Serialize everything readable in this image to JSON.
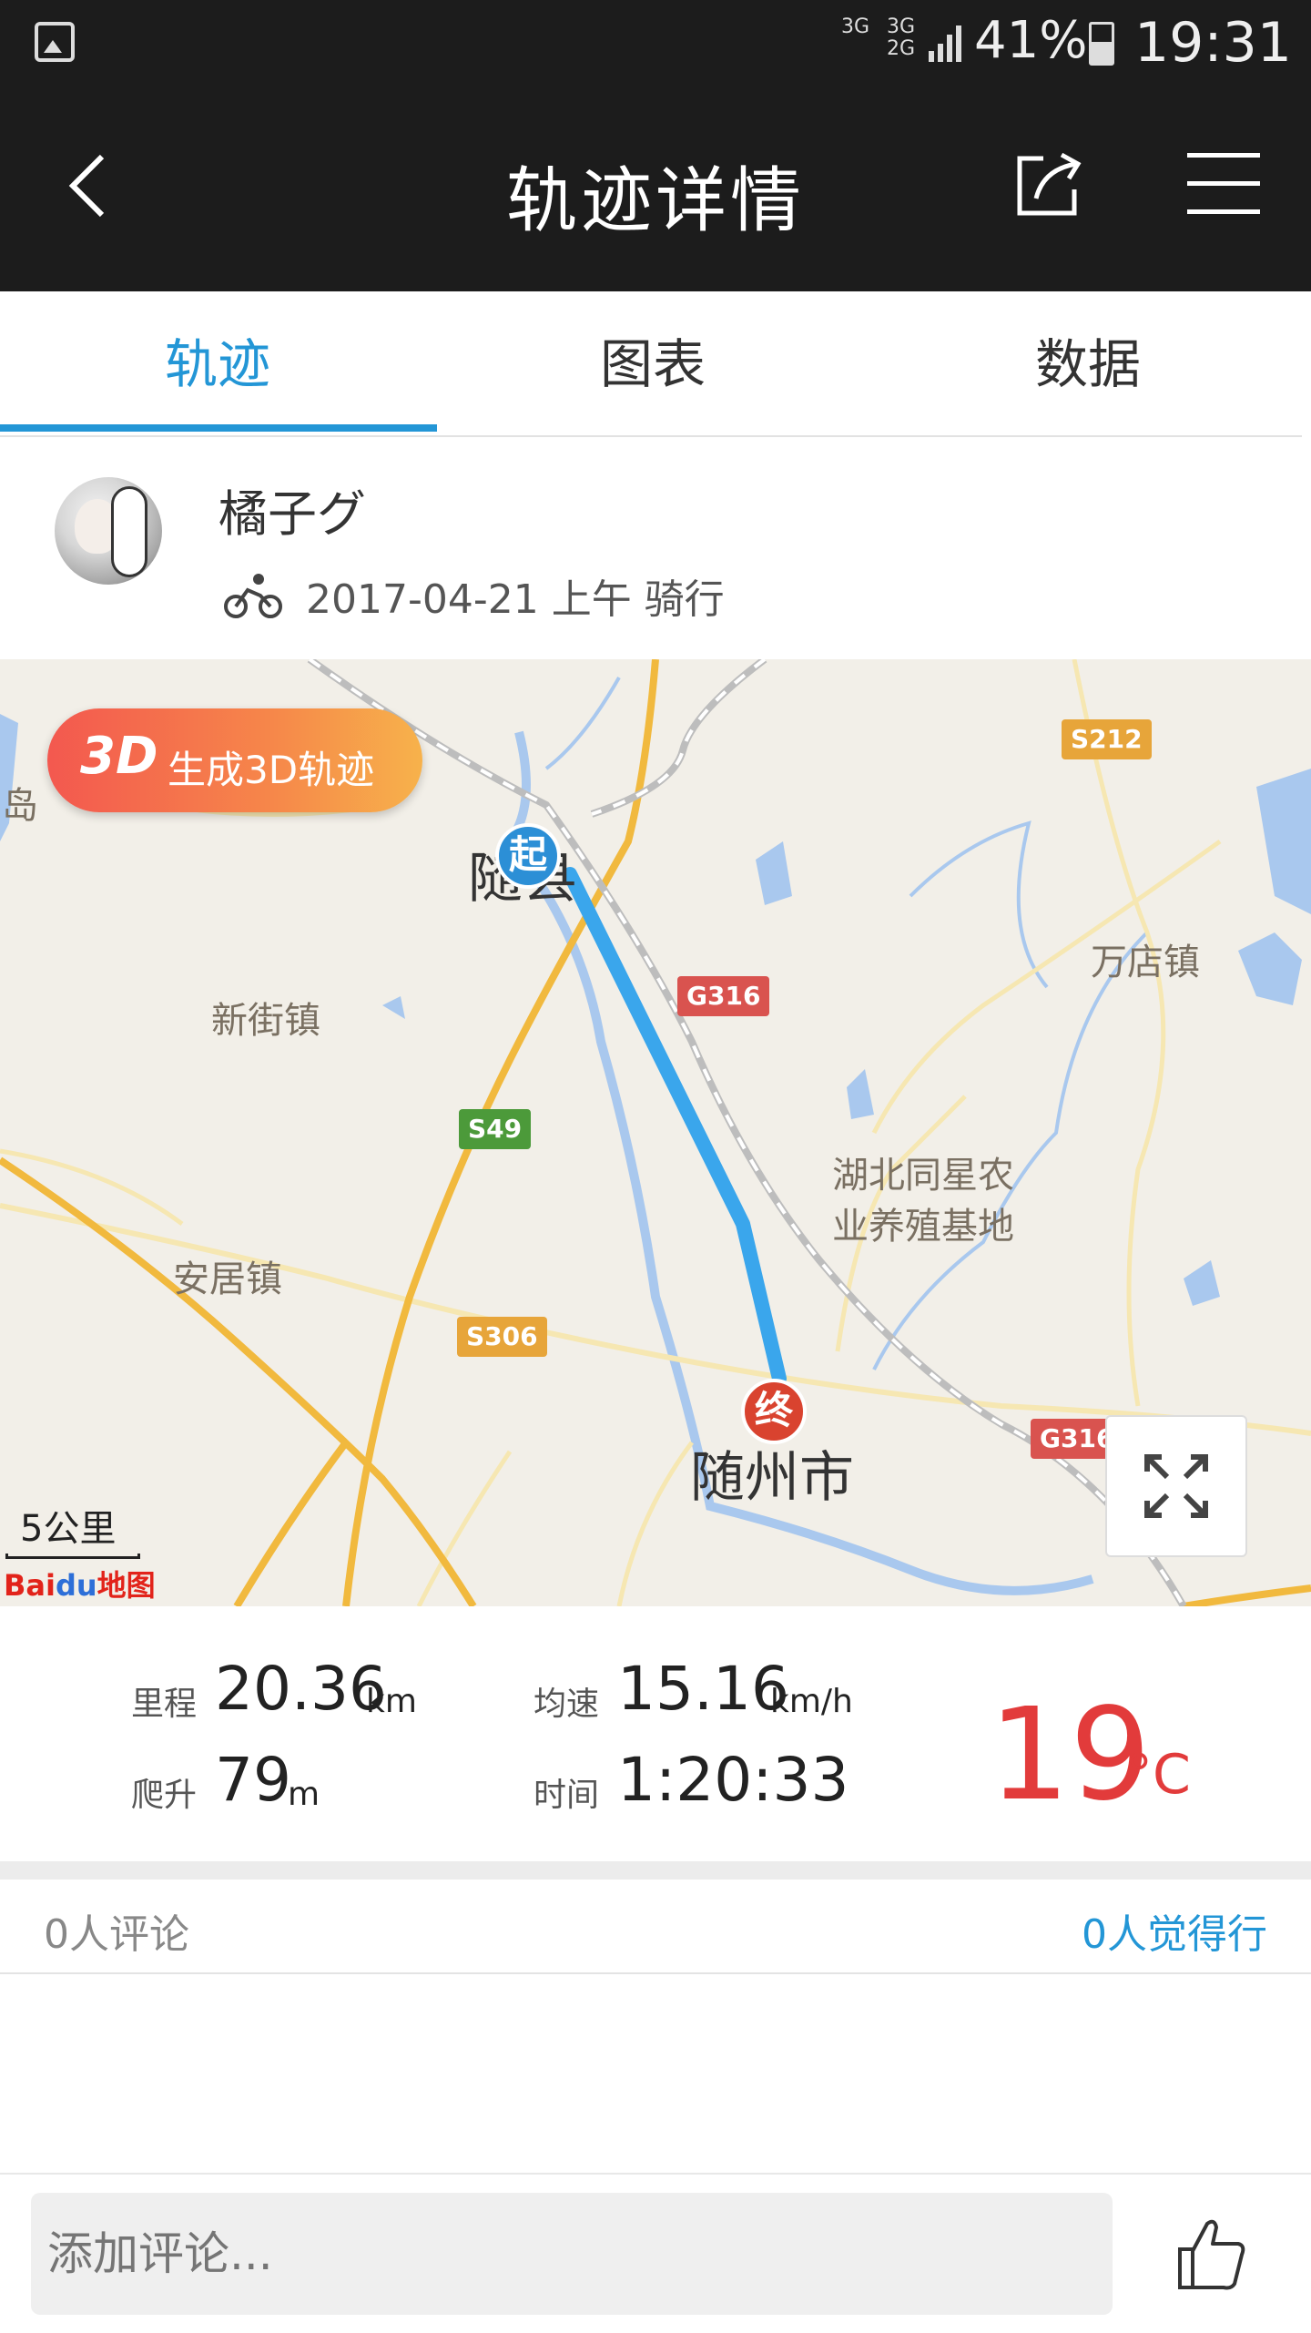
{
  "status_bar": {
    "net1": "3G",
    "net2": "3G",
    "net3": "2G",
    "battery": "41%",
    "time": "19:31"
  },
  "header": {
    "title": "轨迹详情"
  },
  "tabs": [
    {
      "label": "轨迹"
    },
    {
      "label": "图表"
    },
    {
      "label": "数据"
    }
  ],
  "user": {
    "name": "橘子グ",
    "ride_info": "2017-04-21 上午 骑行"
  },
  "map": {
    "btn_3d_big": "3D",
    "btn_3d_text": "生成3D轨迹",
    "places": {
      "suixian": "随县",
      "xinjie": "新街镇",
      "wandian": "万店镇",
      "anju": "安居镇",
      "hubei_line1": "湖北同星农",
      "hubei_line2": "业养殖基地",
      "suizhou": "随州市",
      "dao": "岛"
    },
    "shields": {
      "s212": "S212",
      "g316a": "G316",
      "s49": "S49",
      "s306": "S306",
      "g316b": "G316"
    },
    "start_marker": "起",
    "end_marker": "终",
    "scale": "5公里",
    "logo_bai": "Bai",
    "logo_du": "du",
    "logo_map": "地图",
    "route_color": "#3aa6ec"
  },
  "stats": {
    "distance_label": "里程",
    "distance_value": "20.36",
    "distance_unit": "km",
    "speed_label": "均速",
    "speed_value": "15.16",
    "speed_unit": "km/h",
    "climb_label": "爬升",
    "climb_value": "79",
    "climb_unit": "m",
    "time_label": "时间",
    "time_value": "1:20:33",
    "temperature": "19",
    "temperature_unit": "°C"
  },
  "comments": {
    "count_text": "0人评论",
    "like_text": "0人觉得行"
  },
  "bottom": {
    "input_placeholder": "添加评论..."
  },
  "colors": {
    "accent": "#2396d6",
    "temperature": "#e23b3b",
    "header_bg": "#1c1c1c"
  }
}
